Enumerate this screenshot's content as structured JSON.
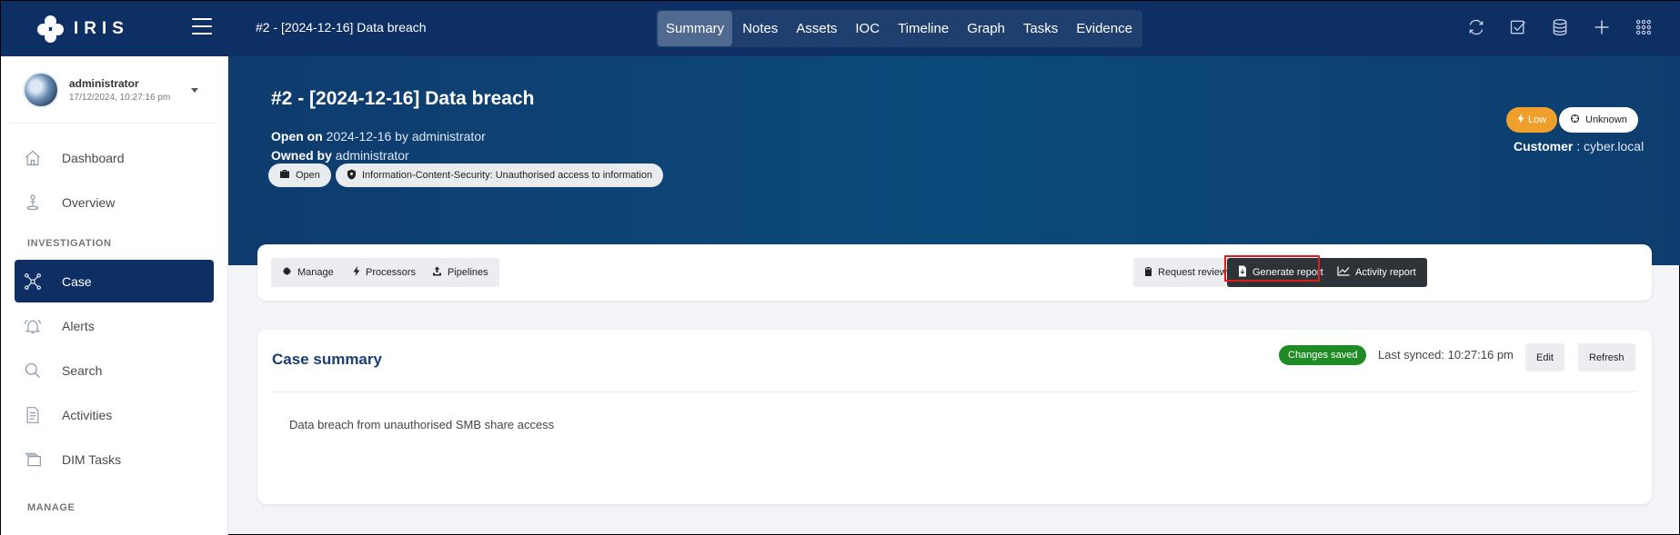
{
  "app": {
    "logo_text": "IRIS",
    "case_title": "#2 - [2024-12-16] Data breach"
  },
  "tabs": [
    {
      "label": "Summary",
      "active": true
    },
    {
      "label": "Notes"
    },
    {
      "label": "Assets"
    },
    {
      "label": "IOC"
    },
    {
      "label": "Timeline"
    },
    {
      "label": "Graph"
    },
    {
      "label": "Tasks"
    },
    {
      "label": "Evidence"
    }
  ],
  "top_icons": [
    "sync-icon",
    "checkbox-icon",
    "database-icon",
    "plus-icon",
    "grid-icon"
  ],
  "user": {
    "name": "administrator",
    "timestamp": "17/12/2024, 10:27:16 pm"
  },
  "sidebar": {
    "items_top": [
      {
        "label": "Dashboard",
        "icon": "home-icon"
      },
      {
        "label": "Overview",
        "icon": "person-pin-icon"
      }
    ],
    "section_investigation": "INVESTIGATION",
    "items_investigation": [
      {
        "label": "Case",
        "icon": "network-icon",
        "active": true
      },
      {
        "label": "Alerts",
        "icon": "bell-icon"
      },
      {
        "label": "Search",
        "icon": "search-icon"
      },
      {
        "label": "Activities",
        "icon": "document-icon"
      },
      {
        "label": "DIM Tasks",
        "icon": "windows-icon"
      }
    ],
    "section_manage": "MANAGE"
  },
  "case": {
    "heading": "#2 - [2024-12-16] Data breach",
    "open_on_label": "Open on",
    "open_on_value": "2024-12-16 by administrator",
    "owned_by_label": "Owned by",
    "owned_by_value": "administrator",
    "status_pill": "Open",
    "classification_pill": "Information-Content-Security: Unauthorised access to information",
    "severity": "Low",
    "state": "Unknown",
    "customer_label": "Customer",
    "customer_value": "cyber.local"
  },
  "actions": {
    "manage": "Manage",
    "processors": "Processors",
    "pipelines": "Pipelines",
    "request_review": "Request review",
    "generate_report": "Generate report",
    "activity_report": "Activity report"
  },
  "summary": {
    "title": "Case summary",
    "status_badge": "Changes saved",
    "last_synced": "Last synced: 10:27:16 pm",
    "edit": "Edit",
    "refresh": "Refresh",
    "body": "Data breach from unauthorised SMB share access"
  },
  "colors": {
    "navbar": "#0d2f63",
    "header_gradient_start": "#0f3b6e",
    "active_nav": "#0d2f63",
    "severity_low": "#f0a02a",
    "saved_badge": "#1f8b24",
    "dark_button": "#2e3338",
    "highlight": "#e51b1b"
  }
}
